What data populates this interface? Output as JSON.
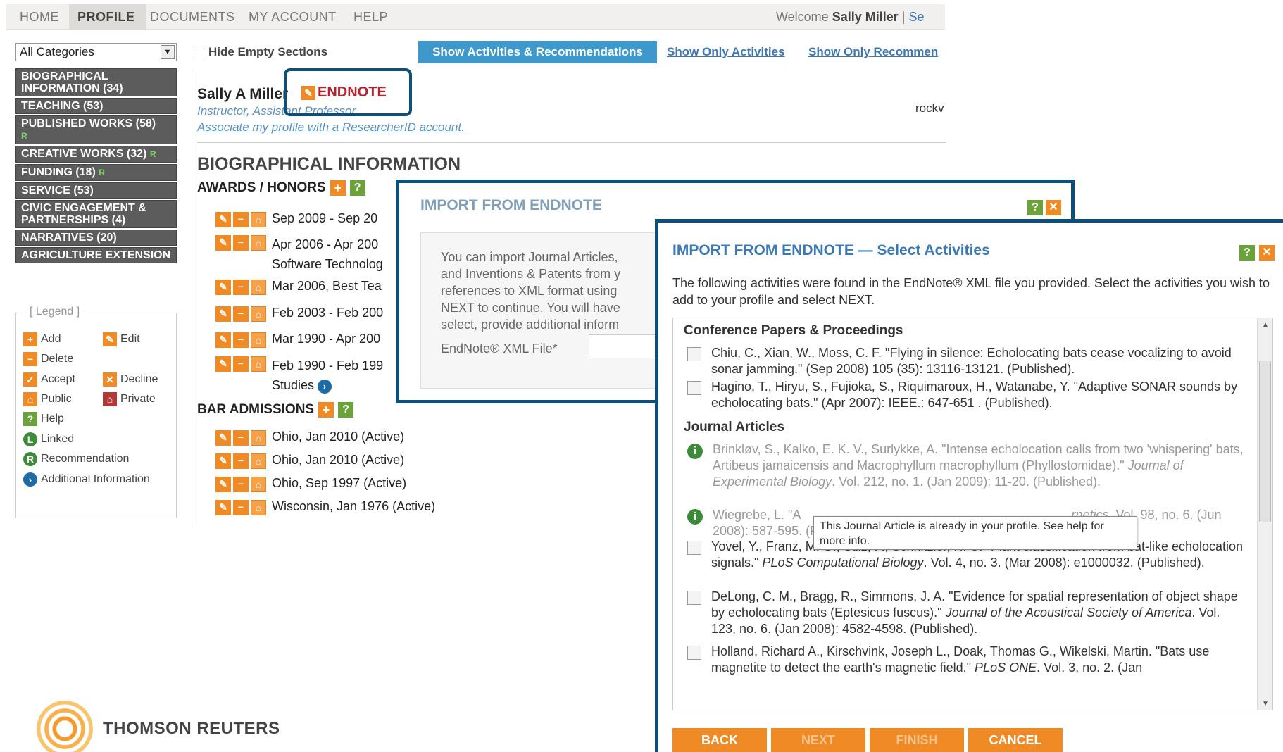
{
  "nav": {
    "tabs": [
      "HOME",
      "PROFILE",
      "DOCUMENTS",
      "MY ACCOUNT",
      "HELP"
    ],
    "welcome_prefix": "Welcome",
    "user_name": "Sally Miller",
    "separator": "|",
    "link_partial": "Se"
  },
  "filters": {
    "category": "All Categories",
    "hide_empty_label": "Hide Empty Sections",
    "btn_show_all": "Show Activities & Recommendations",
    "btn_only_activities": "Show Only Activities",
    "btn_only_recommendations": "Show Only Recommen"
  },
  "sidebar": {
    "items": [
      {
        "label": "BIOGRAPHICAL INFORMATION (34)",
        "r": ""
      },
      {
        "label": "TEACHING (53)",
        "r": ""
      },
      {
        "label": "PUBLISHED WORKS (58)",
        "r": "R"
      },
      {
        "label": "CREATIVE WORKS (32)",
        "r": "R"
      },
      {
        "label": "FUNDING (18)",
        "r": "R"
      },
      {
        "label": "SERVICE (53)",
        "r": ""
      },
      {
        "label": "CIVIC ENGAGEMENT & PARTNERSHIPS (4)",
        "r": ""
      },
      {
        "label": "NARRATIVES (20)",
        "r": ""
      },
      {
        "label": "AGRICULTURE EXTENSION",
        "r": ""
      }
    ]
  },
  "legend": {
    "title": "[ Legend ]",
    "add": "Add",
    "edit": "Edit",
    "delete": "Delete",
    "accept": "Accept",
    "decline": "Decline",
    "public": "Public",
    "private": "Private",
    "help": "Help",
    "linked": "Linked",
    "recommendation": "Recommendation",
    "additional": "Additional Information"
  },
  "profile": {
    "name": "Sally A Miller",
    "endnote": "ENDNOTE",
    "title": "Instructor, Assistant Professor",
    "associate_link": "Associate my profile with a ResearcherID account.",
    "right_partial": "rockv",
    "section_title": "BIOGRAPHICAL INFORMATION",
    "awards_title": "AWARDS / HONORS",
    "awards": [
      {
        "text": "Sep 2009 - Sep 20",
        "sub": ""
      },
      {
        "text": "Apr 2006 - Apr 200",
        "sub": "Software Technolog"
      },
      {
        "text": "Mar 2006, Best Tea",
        "sub": ""
      },
      {
        "text": "Feb 2003 - Feb 200",
        "sub": ""
      },
      {
        "text": "Mar 1990 - Apr 200",
        "sub": ""
      },
      {
        "text": "Feb 1990 - Feb 199",
        "sub": "Studies"
      }
    ],
    "bar_title": "BAR ADMISSIONS",
    "bar": [
      "Ohio, Jan 2010 (Active)",
      "Ohio, Jan 2010 (Active)",
      "Ohio, Sep 1997 (Active)",
      "Wisconsin, Jan 1976 (Active)"
    ]
  },
  "dialog1": {
    "title": "IMPORT FROM ENDNOTE",
    "body_lines": [
      "You can import Journal Articles,",
      "and Inventions & Patents from y",
      "references to XML format using",
      "NEXT to continue. You will have",
      "select, provide additional inform"
    ],
    "field_label": "EndNote® XML File*"
  },
  "dialog2": {
    "title": "IMPORT FROM ENDNOTE — Select Activities",
    "intro": "The following activities were found in the EndNote® XML file you provided. Select the activities you wish to add to your profile and select NEXT.",
    "sec_conf": "Conference Papers & Proceedings",
    "conf": [
      "Chiu, C., Xian, W., Moss, C. F. \"Flying in silence: Echolocating bats cease vocalizing to avoid sonar jamming.\" (Sep 2008) 105 (35): 13116-13121. (Published).",
      "Hagino, T., Hiryu, S., Fujioka, S., Riquimaroux, H., Watanabe, Y. \"Adaptive SONAR sounds by echolocating bats.\" (Apr 2007): IEEE.: 647-651 . (Published)."
    ],
    "sec_journal": "Journal Articles",
    "j1": {
      "a": "Brinkløv, S., Kalko, E. K. V., Surlykke, A. \"Intense echolocation calls from two 'whispering' bats, Artibeus jamaicensis and Macrophyllum macrophyllum (Phyllostomidae).\" ",
      "b": "Journal of Experimental Biology",
      "c": ". Vol. 212, no. 1. (Jan 2009): 11-20. (Published)."
    },
    "j2": {
      "a": "Wiegrebe, L. \"A",
      "b": "rnetics",
      "c": ". Vol. 98, no. 6. (Jun 2008): 587-595. (Published)."
    },
    "j3": {
      "a": "Yovel, Y., Franz, M. O., Stilz, P., Schnitzler, H. U. \"Plant classification from bat-like echolocation signals.\" ",
      "b": "PLoS Computational Biology",
      "c": ". Vol. 4, no. 3. (Mar 2008): e1000032. (Published)."
    },
    "j4": {
      "a": "DeLong, C. M., Bragg, R., Simmons, J. A. \"Evidence for spatial representation of object shape by echolocating bats (Eptesicus fuscus).\" ",
      "b": "Journal of the Acoustical Society of America",
      "c": ". Vol. 123, no. 6. (Jan 2008): 4582-4598. (Published)."
    },
    "j5": {
      "a": "Holland, Richard A., Kirschvink, Joseph L., Doak, Thomas G., Wikelski, Martin. \"Bats use magnetite to detect the earth's magnetic field.\" ",
      "b": "PLoS ONE",
      "c": ". Vol. 3, no. 2. (Jan"
    },
    "tooltip": "This Journal Article is already in your profile. See help for more info.",
    "buttons": {
      "back": "BACK",
      "next": "NEXT",
      "finish": "FINISH",
      "cancel": "CANCEL"
    }
  },
  "logo": {
    "text": "THOMSON REUTERS"
  },
  "colors": {
    "accent": "#3f98cc",
    "orange": "#f08a25",
    "dialog_border": "#0b4f7a",
    "sidebar": "#5c5c5c"
  }
}
